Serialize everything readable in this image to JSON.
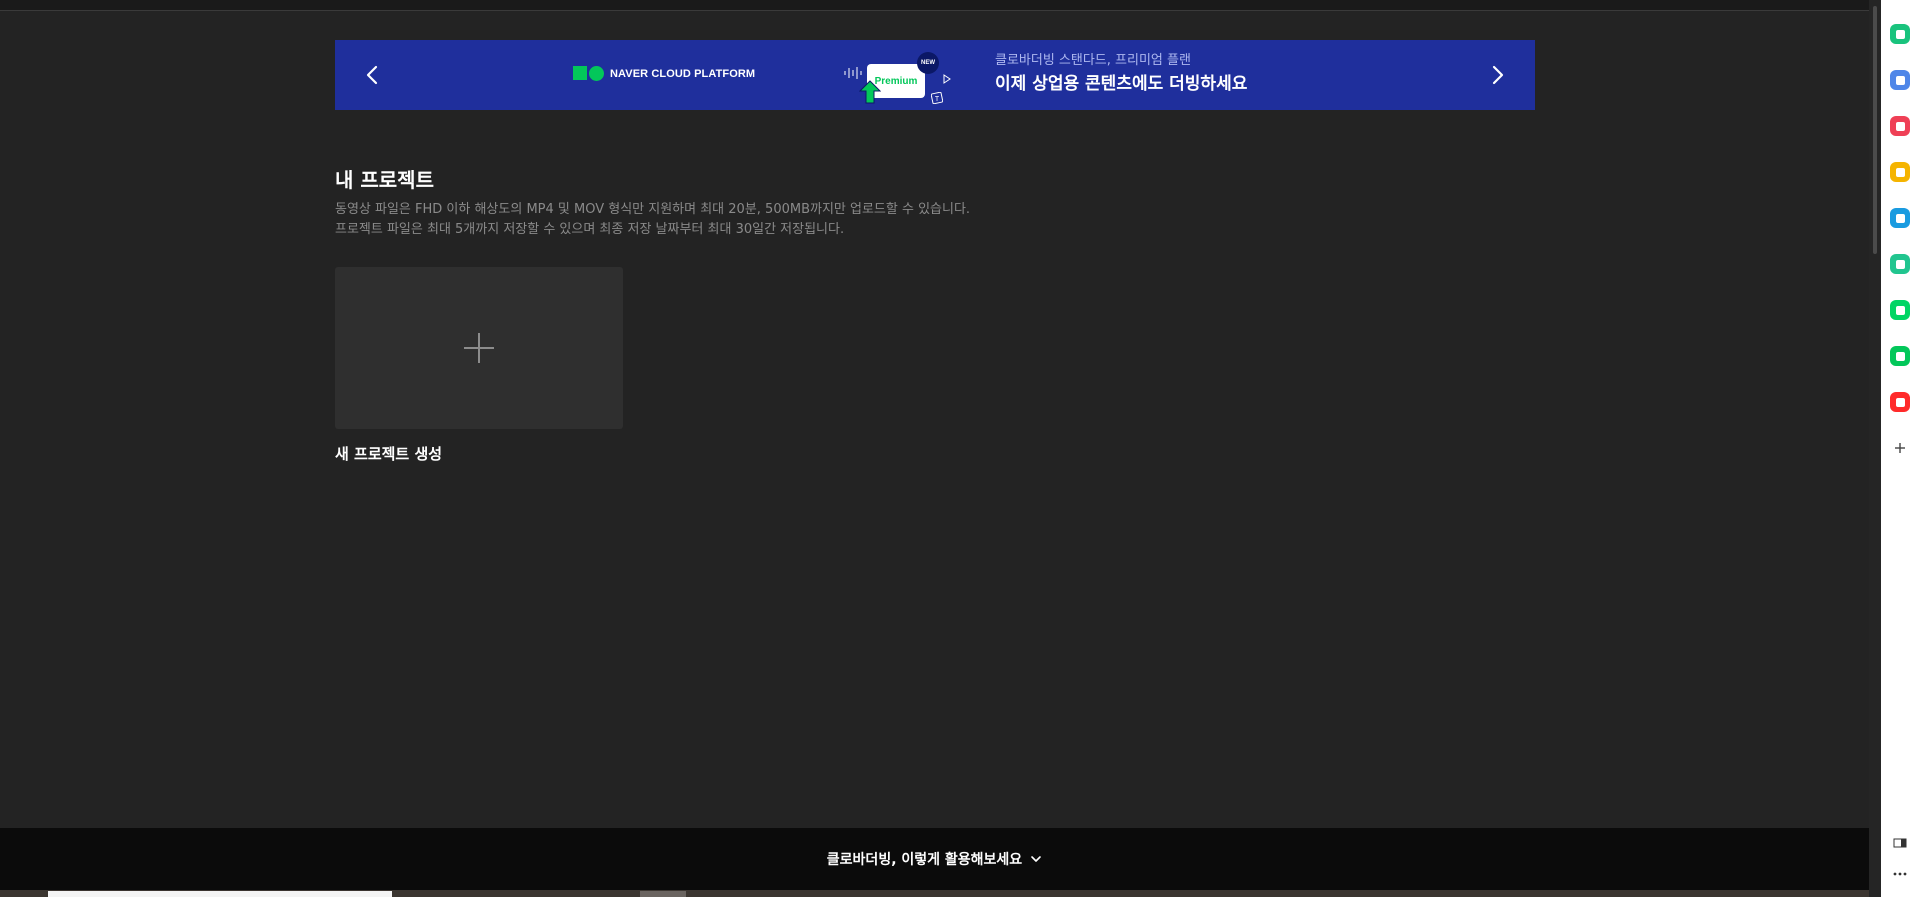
{
  "banner": {
    "logo_text": "NAVER CLOUD PLATFORM",
    "premium_label": "Premium",
    "new_badge": "NEW",
    "subtitle": "클로바더빙 스탠다드, 프리미엄 플랜",
    "title": "이제 상업용 콘텐츠에도 더빙하세요",
    "background_color": "#1f2f9c"
  },
  "projects": {
    "title": "내 프로젝트",
    "desc_line1": "동영상 파일은 FHD 이하 해상도의 MP4 및 MOV 형식만 지원하며 최대 20분, 500MB까지만 업로드할 수 있습니다.",
    "desc_line2": "프로젝트 파일은 최대 5개까지 저장할 수 있으며 최종 저장 날짜부터 최대 30일간 저장됩니다.",
    "new_project_label": "새 프로젝트 생성"
  },
  "bottom_bar": {
    "label": "클로바더빙, 이렇게 활용해보세요"
  },
  "side_rail": {
    "icons": [
      {
        "name": "bell-icon",
        "color": "#19c37d"
      },
      {
        "name": "briefcase-icon",
        "color": "#4f86e8"
      },
      {
        "name": "pocket-icon",
        "color": "#ef4056"
      },
      {
        "name": "star-icon",
        "color": "#f5b400"
      },
      {
        "name": "edge-icon",
        "color": "#1a9be0"
      },
      {
        "name": "play-circle-icon",
        "color": "#21c58f"
      },
      {
        "name": "webtoon-icon",
        "color": "#00d564"
      },
      {
        "name": "note-icon",
        "color": "#03c75a"
      },
      {
        "name": "now-icon",
        "color": "#ff2a2a"
      }
    ]
  }
}
